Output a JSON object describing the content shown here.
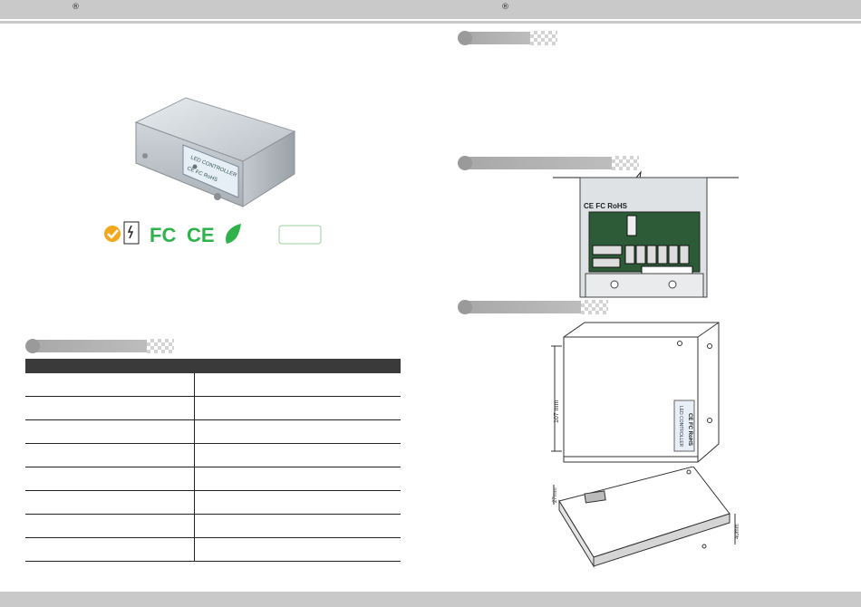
{
  "header": {
    "left_mark": "®",
    "right_mark": "®"
  },
  "product_label": {
    "line1": "LED CONTROLLER",
    "marks": "CE FC RoHS"
  },
  "certifications": [
    {
      "name": "quality-seal-icon"
    },
    {
      "name": "ul-listed-icon"
    },
    {
      "name": "fcc-icon"
    },
    {
      "name": "ce-icon"
    },
    {
      "name": "rohs-leaf-icon"
    }
  ],
  "wiring_label": {
    "marks": "CE FC RoHS"
  },
  "dimensions": {
    "height_label": "107 mm",
    "depth_label": "27mm",
    "side_label": "40mm",
    "label_text": "LED CONTROLLER",
    "label_marks": "CE FC RoHS"
  },
  "spec_table": {
    "rows": [
      {
        "key": "",
        "value": ""
      },
      {
        "key": "",
        "value": ""
      },
      {
        "key": "",
        "value": ""
      },
      {
        "key": "",
        "value": ""
      },
      {
        "key": "",
        "value": ""
      },
      {
        "key": "",
        "value": ""
      },
      {
        "key": "",
        "value": ""
      },
      {
        "key": "",
        "value": ""
      }
    ]
  },
  "colors": {
    "header_bar": "#c9c9c9",
    "table_header": "#3a3a3a",
    "fcc_green": "#2db34a",
    "section_bar": "#a8a8a8"
  }
}
